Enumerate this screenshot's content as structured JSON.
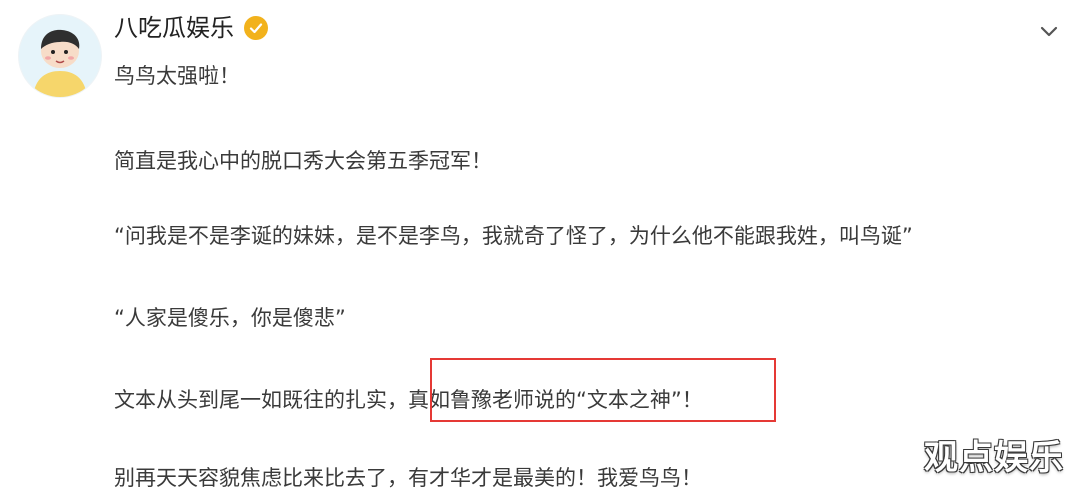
{
  "post": {
    "author": {
      "name": "八吃瓜娱乐",
      "verified_badge_color": "#f2b21c"
    },
    "headline": "鸟鸟太强啦！",
    "paragraphs": [
      "简直是我心中的脱口秀大会第五季冠军！",
      "“问我是不是李诞的妹妹，是不是李鸟，我就奇了怪了，为什么他不能跟我姓，叫鸟诞”",
      "“人家是傻乐，你是傻悲”",
      "文本从头到尾一如既往的扎实，真如鲁豫老师说的“文本之神”！",
      "别再天天容貌焦虑比来比去了，有才华才是最美的！我爱鸟鸟！"
    ],
    "highlight_color": "#e53935"
  },
  "watermark": "观点娱乐",
  "icons": {
    "avatar": "cartoon-avatar",
    "verified": "verified-badge-icon",
    "menu": "chevron-down-icon"
  }
}
